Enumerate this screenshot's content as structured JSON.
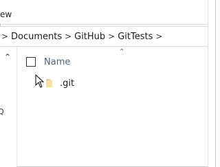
{
  "ribbon": {
    "partial_label": "ew"
  },
  "breadcrumb": {
    "items": [
      "Documents",
      "GitHub",
      "GitTests"
    ],
    "separator": ">"
  },
  "nav": {
    "partial_letter": "Q"
  },
  "list": {
    "column_name": "Name",
    "files": [
      {
        "name": ".git",
        "type": "folder"
      }
    ]
  },
  "colors": {
    "folder": "#f5de8e",
    "header_text": "#4c607a"
  }
}
